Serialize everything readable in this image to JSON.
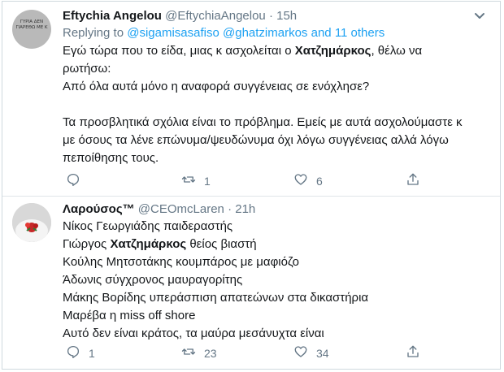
{
  "tweets": [
    {
      "avatar_text": "ΓΥΡΙΑ ΔΕΝ ΓΙΑΡΕΘΩ ΜΕ Κ",
      "name": "Eftychia Angelou",
      "handle": "@EftychiaAngelou",
      "dot": "·",
      "time": "15h",
      "replying_prefix": "Replying to",
      "replying_mention_1": "@sigamisasafiso",
      "replying_mention_2": "@ghatzimarkos",
      "replying_and": "and",
      "replying_others": "11 others",
      "lines": [
        {
          "pre": "Εγώ τώρα που το είδα, μιας κ ασχολείται ο ",
          "bold": "Χατζημάρκος",
          "post": ", θέλω να"
        },
        {
          "text": "ρωτήσω:"
        },
        {
          "text": "Από όλα αυτά μόνο η αναφορά συγγένειας σε ενόχλησε?"
        },
        {
          "text": ""
        },
        {
          "text": "Τα προσβλητικά σχόλια είναι το πρόβλημα. Εμείς με αυτά ασχολούμαστε κ"
        },
        {
          "text": "με όσους τα λένε επώνυμα/ψευδώνυμα όχι λόγω συγγένειας αλλά λόγω"
        },
        {
          "text": "πεποίθησης τους."
        }
      ],
      "actions": {
        "reply_count": "",
        "retweet_count": "1",
        "like_count": "6"
      }
    },
    {
      "name": "Λαρούσος™",
      "handle": "@CEOmcLaren",
      "dot": "·",
      "time": "21h",
      "lines": [
        {
          "text": "Νίκος Γεωργιάδης παιδεραστής"
        },
        {
          "pre": "Γιώργος ",
          "bold": "Χατζημάρκος",
          "post": " θείος βιαστή"
        },
        {
          "text": "Κούλης Μητσοτάκης κουμπάρος με μαφιόζο"
        },
        {
          "text": "Άδωνις σύγχρονος μαυραγορίτης"
        },
        {
          "text": "Μάκης Βορίδης υπεράσπιση απατεώνων στα δικαστήρια"
        },
        {
          "text": "Μαρέβα η miss off shore"
        },
        {
          "text": "Αυτό δεν είναι κράτος, τα μαύρα μεσάνυχτα είναι"
        }
      ],
      "actions": {
        "reply_count": "1",
        "retweet_count": "23",
        "like_count": "34"
      }
    }
  ],
  "icons": [
    "chevron-down-icon",
    "reply-icon",
    "retweet-icon",
    "like-icon",
    "share-icon"
  ],
  "colors": {
    "accent": "#1da1f2",
    "muted": "#657786",
    "text": "#14171a",
    "border": "#cfd9de"
  }
}
